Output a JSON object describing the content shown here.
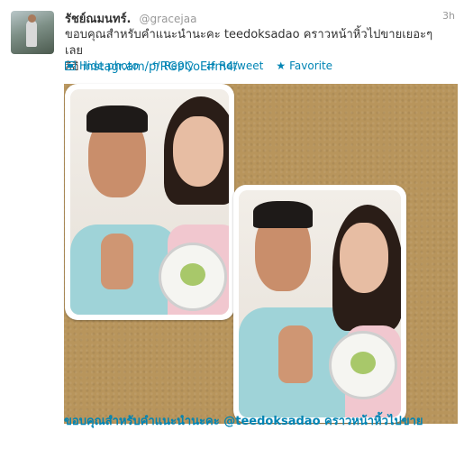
{
  "tweet": {
    "name": "รัชย์ณมนทร์.",
    "handle": "@gracejaa",
    "time": "3h",
    "text_line1": "ขอบคุณสำหรับคำแนะนำนะคะ teedoksadao คราวหน้าหิ้วไปขายเยอะๆเลย",
    "text_line2_prefix": "อิอิ ",
    "link": "instagr.am/p/RG9CoElfm4/",
    "actions": {
      "hide_photo": "Hide photo",
      "reply": "Reply",
      "retweet": "Retweet",
      "favorite": "Favorite"
    },
    "caption_prefix": "ขอบคุณสำหรับคำแนะนำนะคะ ",
    "caption_mention": "@teedoksadao",
    "caption_suffix": " คราวหน้าหิ้วไปขาย"
  },
  "colors": {
    "link": "#0084b4",
    "muted": "#999999",
    "media_bg": "#b8955c"
  }
}
